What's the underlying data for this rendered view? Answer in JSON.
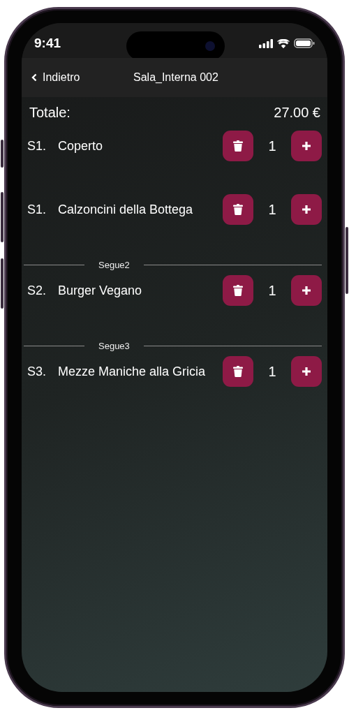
{
  "status_bar": {
    "time": "9:41"
  },
  "nav": {
    "back": "Indietro",
    "title": "Sala_Interna 002"
  },
  "total": {
    "label": "Totale:",
    "amount": "27.00 €"
  },
  "courses": [
    {
      "items": [
        {
          "course": "S1.",
          "name": "Coperto",
          "quantity": "1"
        },
        {
          "course": "S1.",
          "name": "Calzoncini della Bottega",
          "quantity": "1"
        }
      ]
    },
    {
      "label": "Segue2",
      "items": [
        {
          "course": "S2.",
          "name": "Burger Vegano",
          "quantity": "1"
        }
      ]
    },
    {
      "label": "Segue3",
      "items": [
        {
          "course": "S3.",
          "name": "Mezze Maniche alla Gricia",
          "quantity": "1"
        }
      ]
    }
  ]
}
